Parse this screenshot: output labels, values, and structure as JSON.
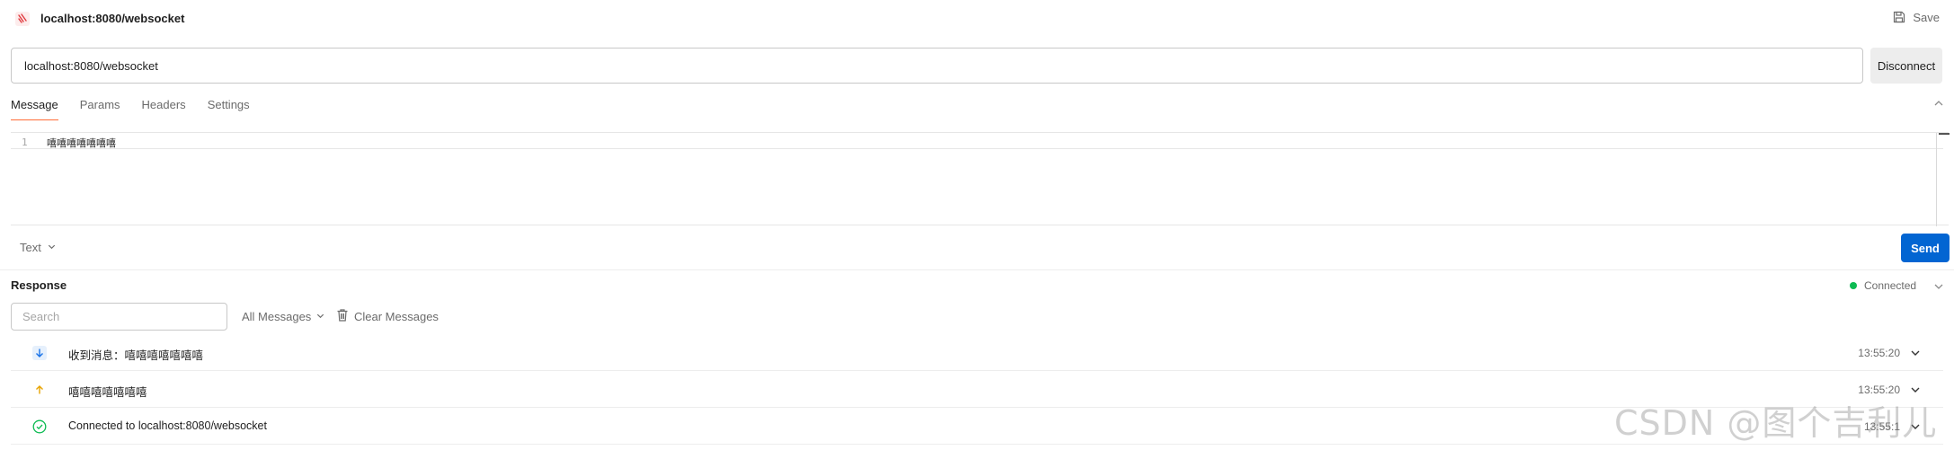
{
  "header": {
    "tab_title": "localhost:8080/websocket",
    "save_label": "Save"
  },
  "request": {
    "url": "localhost:8080/websocket",
    "disconnect_label": "Disconnect"
  },
  "tabs": [
    {
      "label": "Message",
      "active": true
    },
    {
      "label": "Params",
      "active": false
    },
    {
      "label": "Headers",
      "active": false
    },
    {
      "label": "Settings",
      "active": false
    }
  ],
  "editor": {
    "line_number": "1",
    "content": "嘻嘻嘻嘻嘻嘻嘻"
  },
  "composer": {
    "format_label": "Text",
    "send_label": "Send"
  },
  "response": {
    "title": "Response",
    "status_label": "Connected",
    "search_placeholder": "Search",
    "filter_label": "All Messages",
    "clear_label": "Clear Messages",
    "messages": [
      {
        "direction": "incoming",
        "text": "收到消息：嘻嘻嘻嘻嘻嘻嘻",
        "time": "13:55:20"
      },
      {
        "direction": "outgoing",
        "text": "嘻嘻嘻嘻嘻嘻嘻",
        "time": "13:55:20"
      },
      {
        "direction": "connected",
        "text": "Connected to localhost:8080/websocket",
        "time": "13:55:1"
      }
    ]
  },
  "watermark": "CSDN @图个吉利儿",
  "colors": {
    "accent_orange": "#ff6c37",
    "send_blue": "#0265d2",
    "connected_green": "#0cbb52",
    "incoming_blue": "#1a73e8",
    "outgoing_orange": "#e8a400"
  },
  "icons": {
    "app": "websocket-icon",
    "save": "save-icon",
    "trash": "trash-icon",
    "chevron": "chevron-down-icon"
  }
}
